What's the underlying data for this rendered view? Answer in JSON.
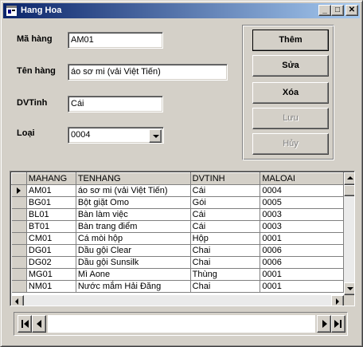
{
  "window": {
    "title": "Hang Hoa",
    "controls": {
      "minimize": "_",
      "maximize": "□",
      "close": "✕"
    }
  },
  "form": {
    "ma_hang": {
      "label": "Mã hàng",
      "value": "AM01"
    },
    "ten_hang": {
      "label": "Tên hàng",
      "value": "áo sơ mi (vải Việt Tiến)"
    },
    "dvt": {
      "label": "DVTinh",
      "value": "Cái"
    },
    "loai": {
      "label": "Loại",
      "value": "0004"
    }
  },
  "buttons": {
    "them": "Thêm",
    "sua": "Sửa",
    "xoa": "Xóa",
    "luu": "Lưu",
    "huy": "Hủy"
  },
  "grid": {
    "columns": [
      "MAHANG",
      "TENHANG",
      "DVTINH",
      "MALOAI"
    ],
    "rows": [
      [
        "AM01",
        "áo sơ mi (vải Việt Tiến)",
        "Cái",
        "0004"
      ],
      [
        "BG01",
        "Bột giặt Omo",
        "Gói",
        "0005"
      ],
      [
        "BL01",
        "Bàn làm việc",
        "Cái",
        "0003"
      ],
      [
        "BT01",
        "Bàn trang điểm",
        "Cái",
        "0003"
      ],
      [
        "CM01",
        "Cá mòi hộp",
        "Hộp",
        "0001"
      ],
      [
        "DG01",
        "Dầu gội Clear",
        "Chai",
        "0006"
      ],
      [
        "DG02",
        "Dầu gội Sunsilk",
        "Chai",
        "0006"
      ],
      [
        "MG01",
        "Mì Aone",
        "Thùng",
        "0001"
      ],
      [
        "NM01",
        "Nước mắm Hải Đăng",
        "Chai",
        "0001"
      ]
    ]
  }
}
